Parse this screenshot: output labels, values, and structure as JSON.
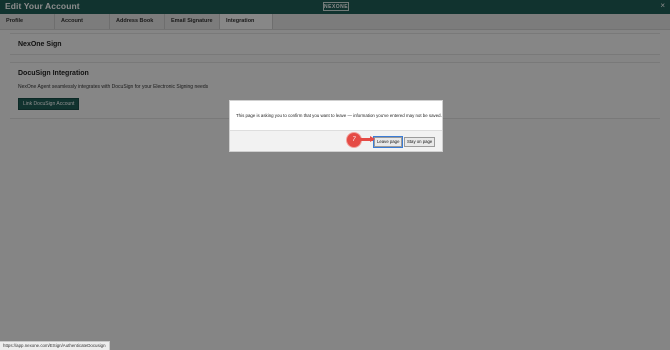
{
  "window": {
    "title": "Edit Your Account",
    "logo": "NEXONE",
    "close_glyph": "×"
  },
  "tabs": [
    {
      "label": "Profile"
    },
    {
      "label": "Account"
    },
    {
      "label": "Address Book"
    },
    {
      "label": "Email Signature"
    },
    {
      "label": "Integration",
      "active": true
    }
  ],
  "sections": {
    "nexone_sign": {
      "heading": "NexOne Sign"
    },
    "docusign": {
      "heading": "DocuSign Integration",
      "description": "NexOne Agent seamlessly integrates with DocuSign for your Electronic Signing needs",
      "button_label": "Link DocuSign Account"
    }
  },
  "dialog": {
    "message": "This page is asking you to confirm that you want to leave — information you've entered may not be saved.",
    "leave_label": "Leave page",
    "stay_label": "Stay on page"
  },
  "annotation": {
    "step": "7"
  },
  "status_bar": {
    "url": "https://app.nexone.com/ESign/AuthenticateDocusign"
  },
  "colors": {
    "header": "#1f5e57",
    "accent_red": "#e54b45"
  }
}
